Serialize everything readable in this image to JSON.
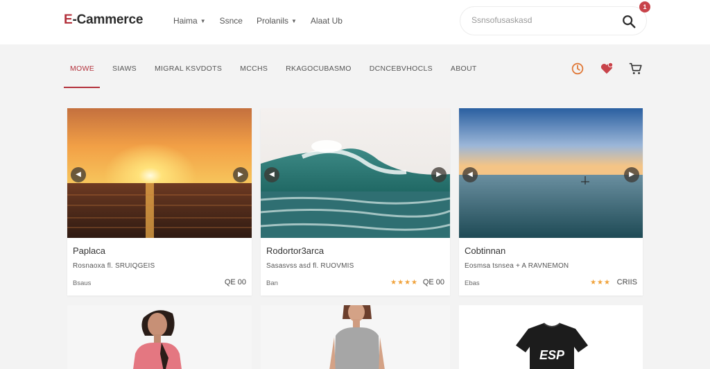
{
  "header": {
    "logo_accent": "E",
    "logo_rest": "-Cammerce",
    "nav": [
      {
        "label": "Haima",
        "dropdown": true
      },
      {
        "label": "Ssnce",
        "dropdown": false
      },
      {
        "label": "Prolanils",
        "dropdown": true
      },
      {
        "label": "Alaat Ub",
        "dropdown": false
      }
    ],
    "search_placeholder": "Ssnsofusaskasd",
    "notification_count": "1"
  },
  "categories": [
    "MOWE",
    "SIAWS",
    "MIGRAL KSVDOTS",
    "MCCHS",
    "RKAGOCUBASMO",
    "DCNCEBVHOCLS",
    "ABOUT"
  ],
  "products": [
    {
      "title": "Paplaca",
      "subtitle": "Rosnaoxa  fl. SRUIQGEIS",
      "meta": "Bsaus",
      "stars": "",
      "price": "QE 00"
    },
    {
      "title": "Rodortor3arca",
      "subtitle": "Sasasvss asd  fl. RUOVMIS",
      "meta": "Ban",
      "stars": "★★★★",
      "price": "QE 00"
    },
    {
      "title": "Cobtinnan",
      "subtitle": "Eosmsa tsnsea + A RAVNEMON",
      "meta": "Ebas",
      "stars": "★★★",
      "price": "CRIIS"
    }
  ],
  "bottom_products": [
    {
      "image": "woman-pink-top"
    },
    {
      "image": "woman-grey-tee"
    },
    {
      "image": "black-tshirt",
      "print_text": "ESP"
    }
  ],
  "colors": {
    "accent": "#b3313b",
    "star": "#f0a23a"
  }
}
